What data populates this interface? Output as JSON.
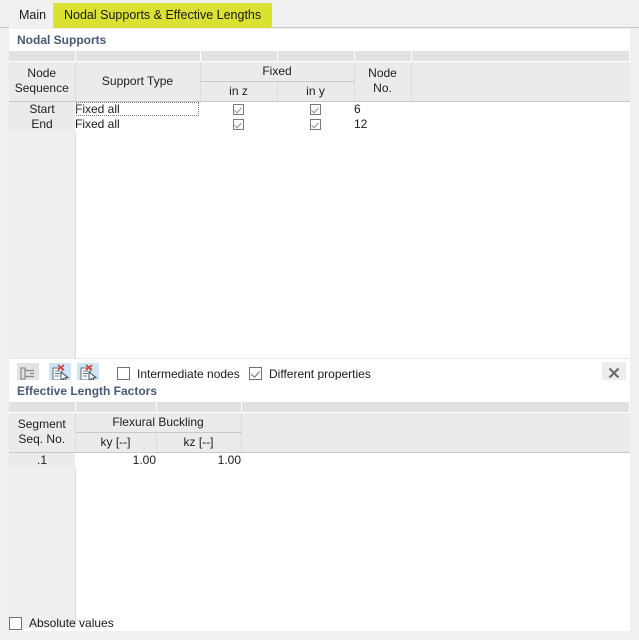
{
  "tabs": [
    {
      "label": "Main",
      "active": false
    },
    {
      "label": "Nodal Supports & Effective Lengths",
      "active": true
    }
  ],
  "nodal_supports": {
    "title": "Nodal Supports",
    "columns": {
      "node_sequence": "Node\nSequence",
      "node_sequence_l1": "Node",
      "node_sequence_l2": "Sequence",
      "support_type": "Support Type",
      "fixed_group": "Fixed",
      "fixed_in_z": "in z",
      "fixed_in_y": "in y",
      "node_no_l1": "Node",
      "node_no_l2": "No."
    },
    "rows": [
      {
        "sequence": "Start",
        "support_type": "Fixed all",
        "support_type_selected": true,
        "in_z": true,
        "in_y": true,
        "node_no": "6"
      },
      {
        "sequence": "End",
        "support_type": "Fixed all",
        "support_type_selected": false,
        "in_z": true,
        "in_y": true,
        "node_no": "12"
      }
    ],
    "toolbar": {
      "buttons": [
        {
          "icon": "indent-list-icon",
          "enabled": false
        },
        {
          "icon": "delete-row-pick-icon",
          "enabled": true
        },
        {
          "icon": "delete-row-pick-icon",
          "enabled": true
        }
      ],
      "close_icon": "close-icon",
      "options": [
        {
          "label": "Intermediate nodes",
          "checked": false
        },
        {
          "label": "Different properties",
          "checked": true
        }
      ]
    }
  },
  "effective_length_factors": {
    "title": "Effective Length Factors",
    "columns": {
      "segment_l1": "Segment",
      "segment_l2": "Seq. No.",
      "flexural_buckling": "Flexural Buckling",
      "ky": "ky [--]",
      "kz": "kz [--]"
    },
    "rows": [
      {
        "segment": ".1",
        "ky": "1.00",
        "kz": "1.00"
      }
    ],
    "options": [
      {
        "label": "Absolute values",
        "checked": false
      }
    ]
  },
  "colors": {
    "tab_active_bg": "#dbe035",
    "section_title": "#4a5878",
    "window_bg": "#f0f0f0",
    "grid_header_bg": "#ebebeb",
    "icon_red": "#d83b2a"
  }
}
